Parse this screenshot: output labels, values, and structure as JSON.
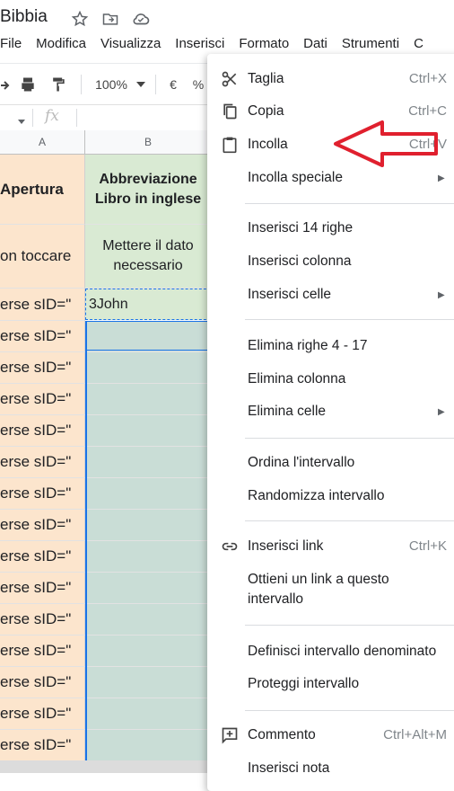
{
  "doc_title": "Bibbia",
  "menubar": [
    "File",
    "Modifica",
    "Visualizza",
    "Inserisci",
    "Formato",
    "Dati",
    "Strumenti",
    "C"
  ],
  "toolbar": {
    "zoom": "100%",
    "currency": "€",
    "percent": "%",
    "fx": "fx"
  },
  "sheet": {
    "columns": [
      "A",
      "B"
    ],
    "header_row": {
      "a": "Apertura",
      "b": "Abbreviazione Libro in inglese"
    },
    "note_row": {
      "a": "on toccare",
      "b": "Mettere il dato necessario"
    },
    "value_row": {
      "a": "erse sID=\"",
      "b": "3John"
    },
    "repeat_a": "erse sID=\"",
    "colors": {
      "colA": "#fce5cd",
      "colB": "#d9ead3",
      "colB_empty": "#c9ddd6",
      "selection": "#1a73e8"
    }
  },
  "context_menu": {
    "cut": {
      "label": "Taglia",
      "shortcut": "Ctrl+X"
    },
    "copy": {
      "label": "Copia",
      "shortcut": "Ctrl+C"
    },
    "paste": {
      "label": "Incolla",
      "shortcut": "Ctrl+V"
    },
    "paste_special": {
      "label": "Incolla speciale"
    },
    "insert_rows": {
      "label": "Inserisci 14 righe"
    },
    "insert_column": {
      "label": "Inserisci colonna"
    },
    "insert_cells": {
      "label": "Inserisci celle"
    },
    "delete_rows": {
      "label": "Elimina righe 4 - 17"
    },
    "delete_column": {
      "label": "Elimina colonna"
    },
    "delete_cells": {
      "label": "Elimina celle"
    },
    "sort_range": {
      "label": "Ordina l'intervallo"
    },
    "randomize_range": {
      "label": "Randomizza intervallo"
    },
    "insert_link": {
      "label": "Inserisci link",
      "shortcut": "Ctrl+K"
    },
    "get_link": {
      "label": "Ottieni un link a questo",
      "label2": "intervallo"
    },
    "define_named_range": {
      "label": "Definisci intervallo denominato"
    },
    "protect_range": {
      "label": "Proteggi intervallo"
    },
    "comment": {
      "label": "Commento",
      "shortcut": "Ctrl+Alt+M"
    },
    "insert_note": {
      "label": "Inserisci nota"
    }
  },
  "annotation_color": "#e0202e"
}
